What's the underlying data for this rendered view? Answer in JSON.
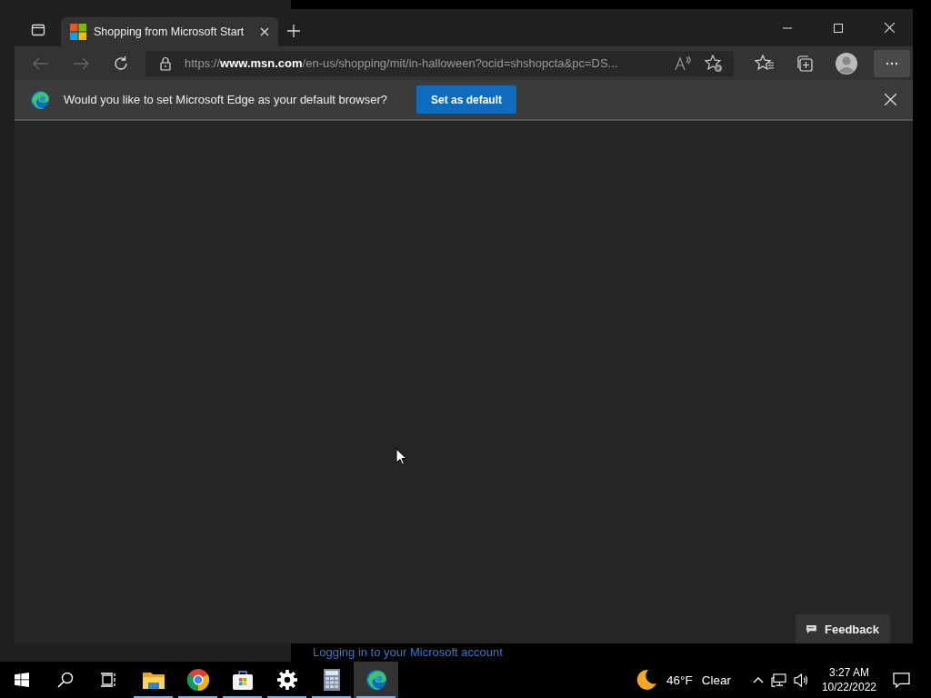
{
  "browser": {
    "tab": {
      "title": "Shopping from Microsoft Start"
    },
    "nav": {
      "back_disabled": true,
      "forward_disabled": true
    },
    "address": {
      "scheme": "https://",
      "host": "www.msn.com",
      "path": "/en-us/shopping/mit/in-halloween?ocid=shshopcta&pc=DS..."
    },
    "infobar": {
      "message": "Would you like to set Microsoft Edge as your default browser?",
      "button": "Set as default"
    },
    "feedback": "Feedback"
  },
  "background_window": {
    "link": "Logging in to your Microsoft account"
  },
  "taskbar": {
    "apps": [
      {
        "kind": "folder",
        "running": true,
        "selected": false
      },
      {
        "kind": "chrome",
        "running": true,
        "selected": false
      },
      {
        "kind": "store",
        "running": true,
        "selected": false
      },
      {
        "kind": "settings",
        "running": true,
        "selected": false
      },
      {
        "kind": "calculator",
        "running": true,
        "selected": false
      },
      {
        "kind": "edge",
        "running": true,
        "selected": true
      }
    ],
    "weather": {
      "temperature": "46°F",
      "condition": "Clear"
    },
    "time": "3:27 AM",
    "date": "10/22/2022"
  }
}
